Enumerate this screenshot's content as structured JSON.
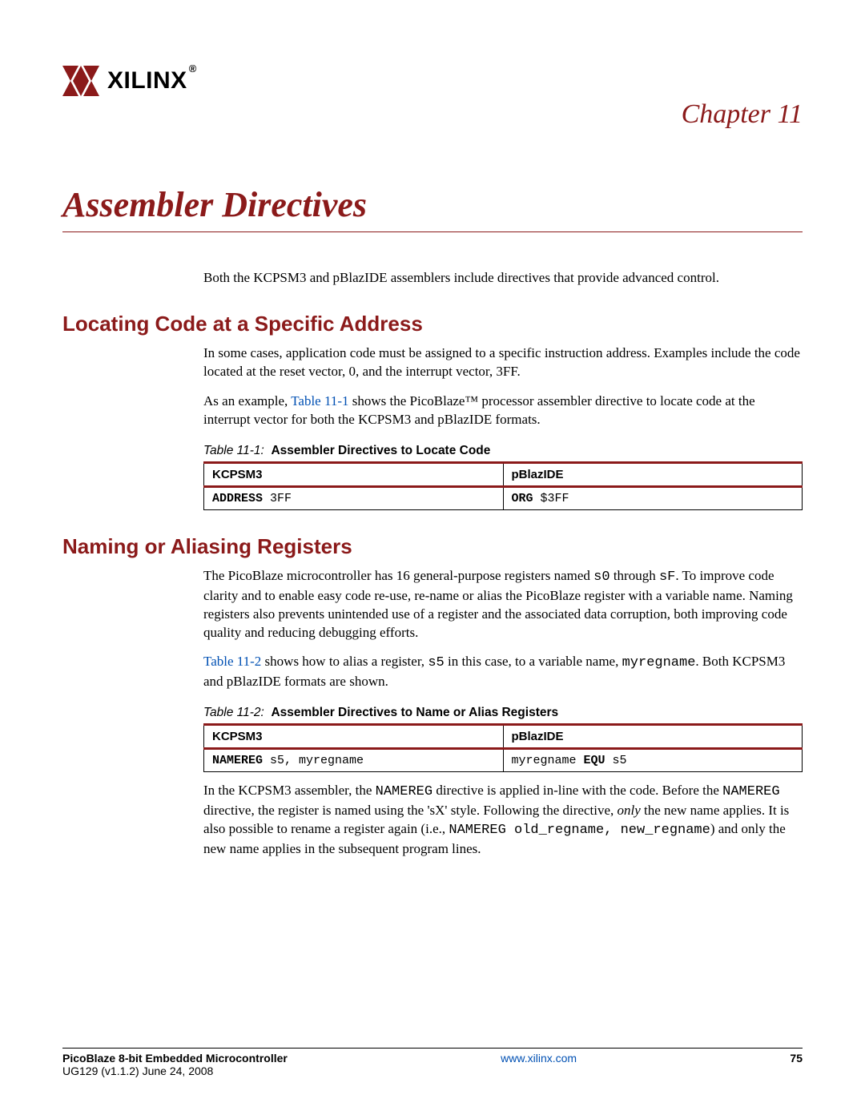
{
  "brand": "XILINX",
  "chapter_label": "Chapter 11",
  "main_title": "Assembler Directives",
  "intro": "Both the KCPSM3 and pBlazIDE assemblers include directives that provide advanced control.",
  "sec1": {
    "heading": "Locating Code at a Specific Address",
    "p1": "In some cases, application code must be assigned to a specific instruction address. Examples include the code located at the reset vector, 0, and the interrupt vector, 3FF.",
    "p2a": "As an example, ",
    "p2_ref": "Table 11-1",
    "p2b": " shows the PicoBlaze™ processor assembler directive to locate code at the interrupt vector for both the KCPSM3 and pBlazIDE formats.",
    "table_caption_ref": "Table 11-1:",
    "table_caption_title": "Assembler Directives to Locate Code",
    "table": {
      "head": [
        "KCPSM3",
        "pBlazIDE"
      ],
      "row": {
        "c1_kw": "ADDRESS",
        "c1_arg": " 3FF",
        "c2_kw": "ORG",
        "c2_arg": " $3FF"
      }
    }
  },
  "sec2": {
    "heading": "Naming or Aliasing Registers",
    "p1a": "The PicoBlaze microcontroller has 16 general-purpose registers named ",
    "p1_m1": "s0",
    "p1b": " through ",
    "p1_m2": "sF",
    "p1c": ". To improve code clarity and to enable easy code re-use, re-name or alias the PicoBlaze register with a variable name. Naming registers also prevents unintended use of a register and the associated data corruption, both improving code quality and reducing debugging efforts.",
    "p2_ref": "Table 11-2",
    "p2a": " shows how to alias a register, ",
    "p2_m1": "s5",
    "p2b": " in this case, to a variable name, ",
    "p2_m2": "myregname",
    "p2c": ". Both KCPSM3 and pBlazIDE formats are shown.",
    "table_caption_ref": "Table 11-2:",
    "table_caption_title": "Assembler Directives to Name or Alias Registers",
    "table": {
      "head": [
        "KCPSM3",
        "pBlazIDE"
      ],
      "row": {
        "c1_kw": "NAMEREG",
        "c1_arg": " s5, myregname",
        "c2_pre": "myregname ",
        "c2_kw": "EQU",
        "c2_arg": " s5"
      }
    },
    "p3a": "In the KCPSM3 assembler, the ",
    "p3_m1": "NAMEREG",
    "p3b": " directive is applied in-line with the code. Before the ",
    "p3_m2": "NAMEREG",
    "p3c": " directive, the register is named using the 'sX' style. Following the directive, ",
    "p3_it": "only",
    "p3d": " the new name applies. It is also possible to rename a register again (i.e., ",
    "p3_m3": "NAMEREG old_regname, new_regname",
    "p3e": ") and only the new name applies in the subsequent program lines."
  },
  "footer": {
    "title": "PicoBlaze 8-bit Embedded Microcontroller",
    "sub": "UG129 (v1.1.2) June 24, 2008",
    "center": "www.xilinx.com",
    "page": "75"
  }
}
